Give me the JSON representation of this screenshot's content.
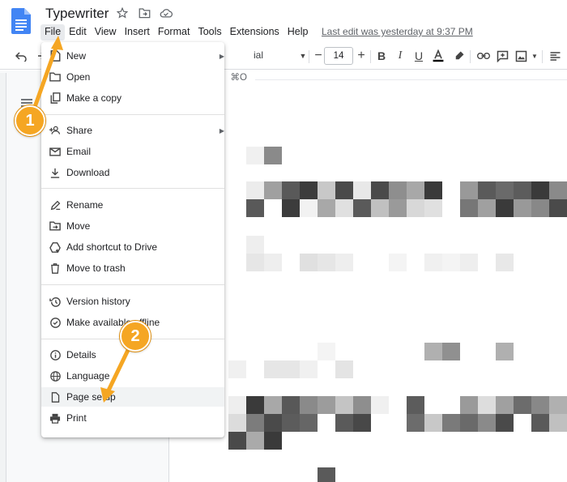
{
  "header": {
    "title": "Typewriter",
    "last_edit": "Last edit was yesterday at 9:37 PM",
    "menus": [
      "File",
      "Edit",
      "View",
      "Insert",
      "Format",
      "Tools",
      "Extensions",
      "Help"
    ]
  },
  "toolbar": {
    "font_name": "ial",
    "font_size": "14"
  },
  "file_menu": {
    "new": "New",
    "open": "Open",
    "open_shortcut": "⌘O",
    "make_copy": "Make a copy",
    "share": "Share",
    "email": "Email",
    "download": "Download",
    "rename": "Rename",
    "move": "Move",
    "add_shortcut": "Add shortcut to Drive",
    "move_trash": "Move to trash",
    "version_history": "Version history",
    "make_offline": "Make available offline",
    "details": "Details",
    "language": "Language",
    "page_setup": "Page setup",
    "print": "Print"
  },
  "callouts": {
    "one": "1",
    "two": "2"
  },
  "colors": {
    "callout": "#f5a623",
    "docs_blue": "#4285f4"
  }
}
